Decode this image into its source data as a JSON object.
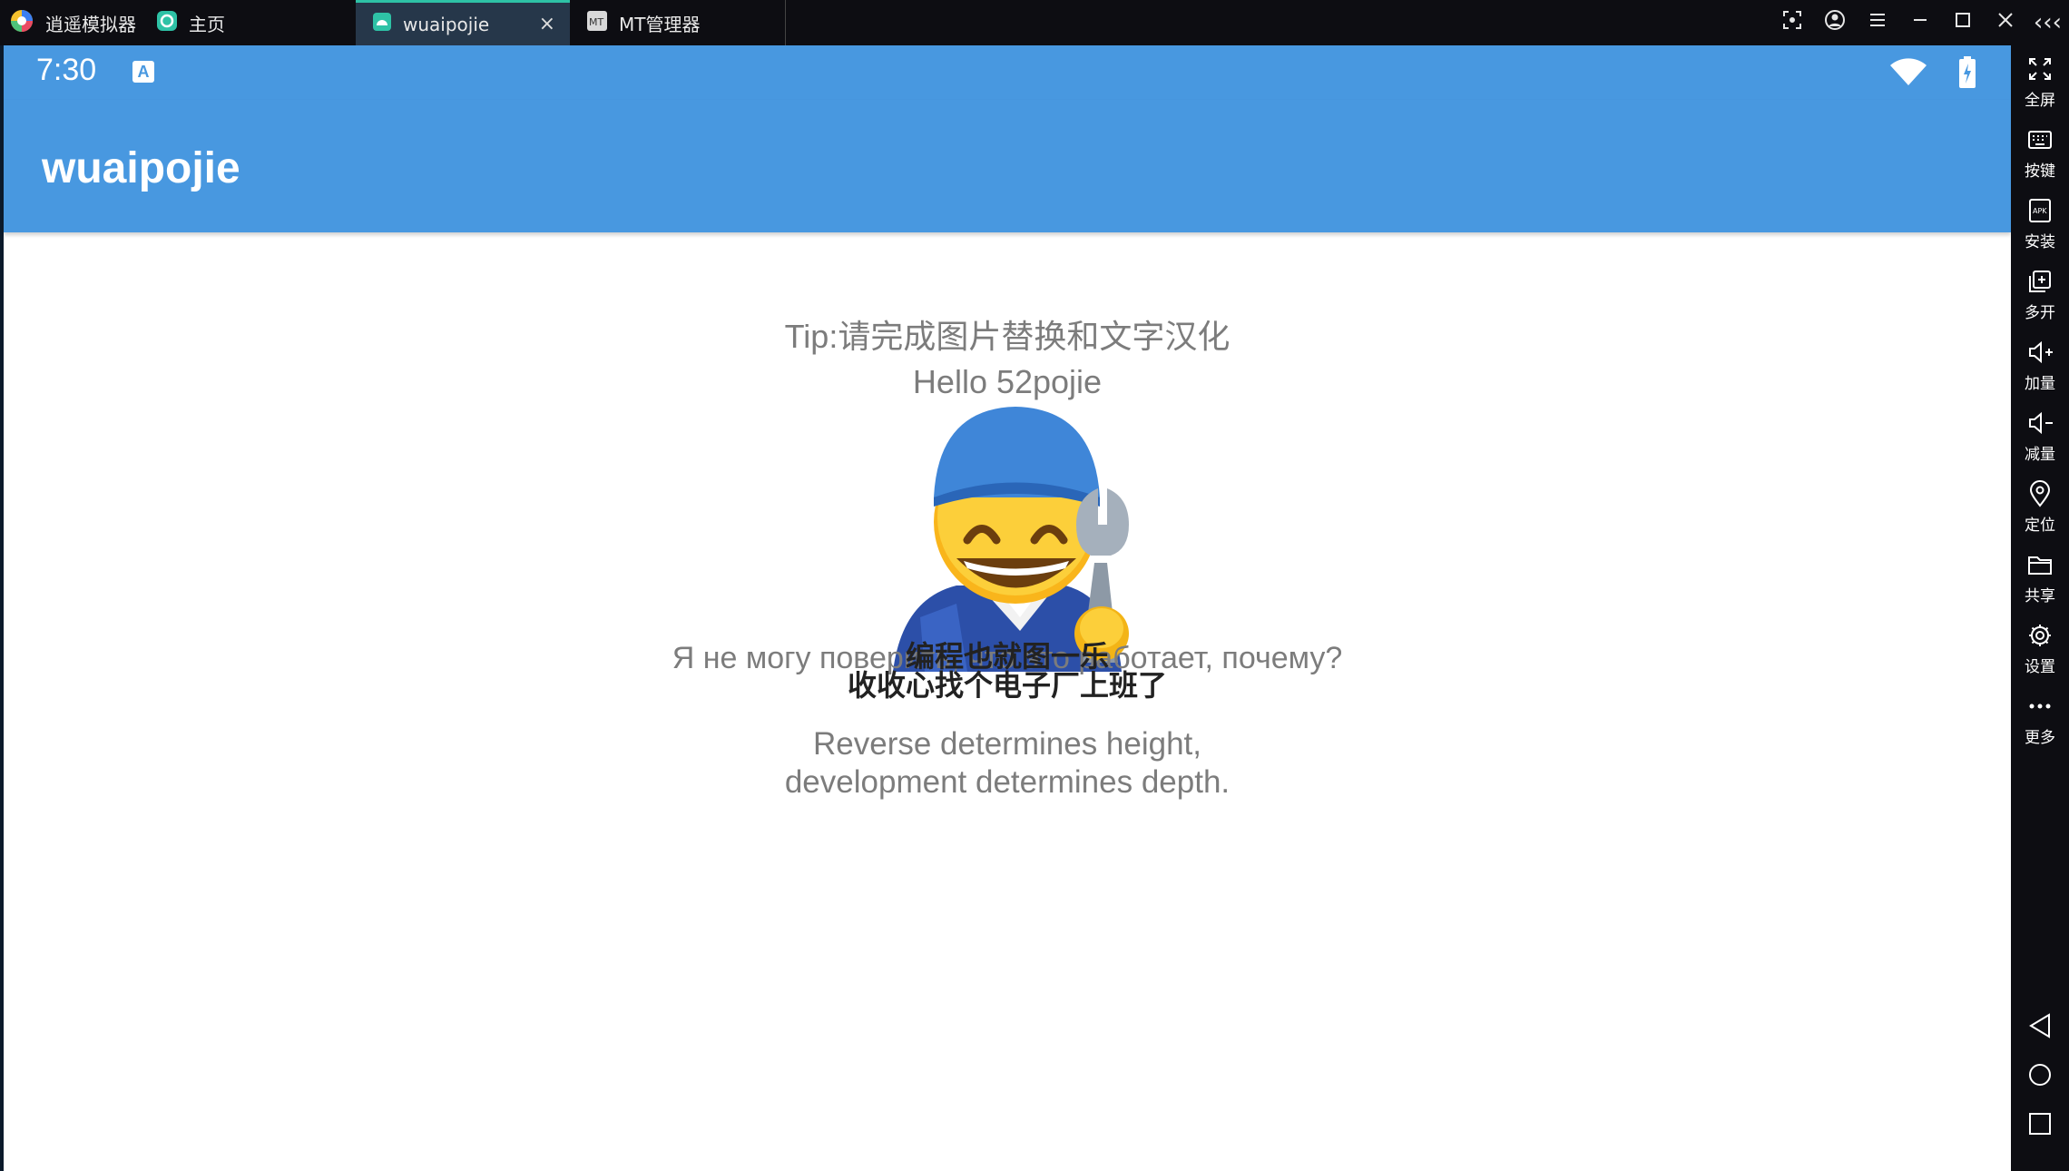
{
  "titlebar": {
    "app_name": "逍遥模拟器",
    "tabs": [
      {
        "label": "主页"
      },
      {
        "label": "wuaipojie"
      },
      {
        "label": "MT管理器"
      }
    ],
    "tab_close": "×"
  },
  "statusbar": {
    "time": "7:30",
    "input_indicator": "A"
  },
  "appbar": {
    "title": "wuaipojie"
  },
  "content": {
    "tip": "Tip:请完成图片替换和文字汉化",
    "hello": "Hello 52pojie",
    "russian": "Я не могу поверить, что это работает, почему?",
    "caption_line1": "编程也就图一乐",
    "caption_line2": "收收心找个电子厂上班了",
    "reverse_line1": "Reverse determines height,",
    "reverse_line2": "development determines depth.",
    "image_icon": "mechanic-emoji"
  },
  "toolbar": {
    "collapse": "‹‹‹",
    "items": [
      {
        "label": "全屏",
        "icon": "fullscreen-icon"
      },
      {
        "label": "按键",
        "icon": "keyboard-icon"
      },
      {
        "label": "安装",
        "icon": "apk-install-icon"
      },
      {
        "label": "多开",
        "icon": "multi-open-icon"
      },
      {
        "label": "加量",
        "icon": "volume-up-icon"
      },
      {
        "label": "减量",
        "icon": "volume-down-icon"
      },
      {
        "label": "定位",
        "icon": "location-icon"
      },
      {
        "label": "共享",
        "icon": "folder-icon"
      },
      {
        "label": "设置",
        "icon": "gear-icon"
      },
      {
        "label": "更多",
        "icon": "more-icon"
      }
    ],
    "nav": [
      "back-icon",
      "home-icon",
      "recents-icon"
    ]
  },
  "colors": {
    "accent": "#4898e0",
    "active_tab_indicator": "#2ec2a6",
    "chrome": "#0d0d12",
    "body_text": "#7c7c7c"
  }
}
